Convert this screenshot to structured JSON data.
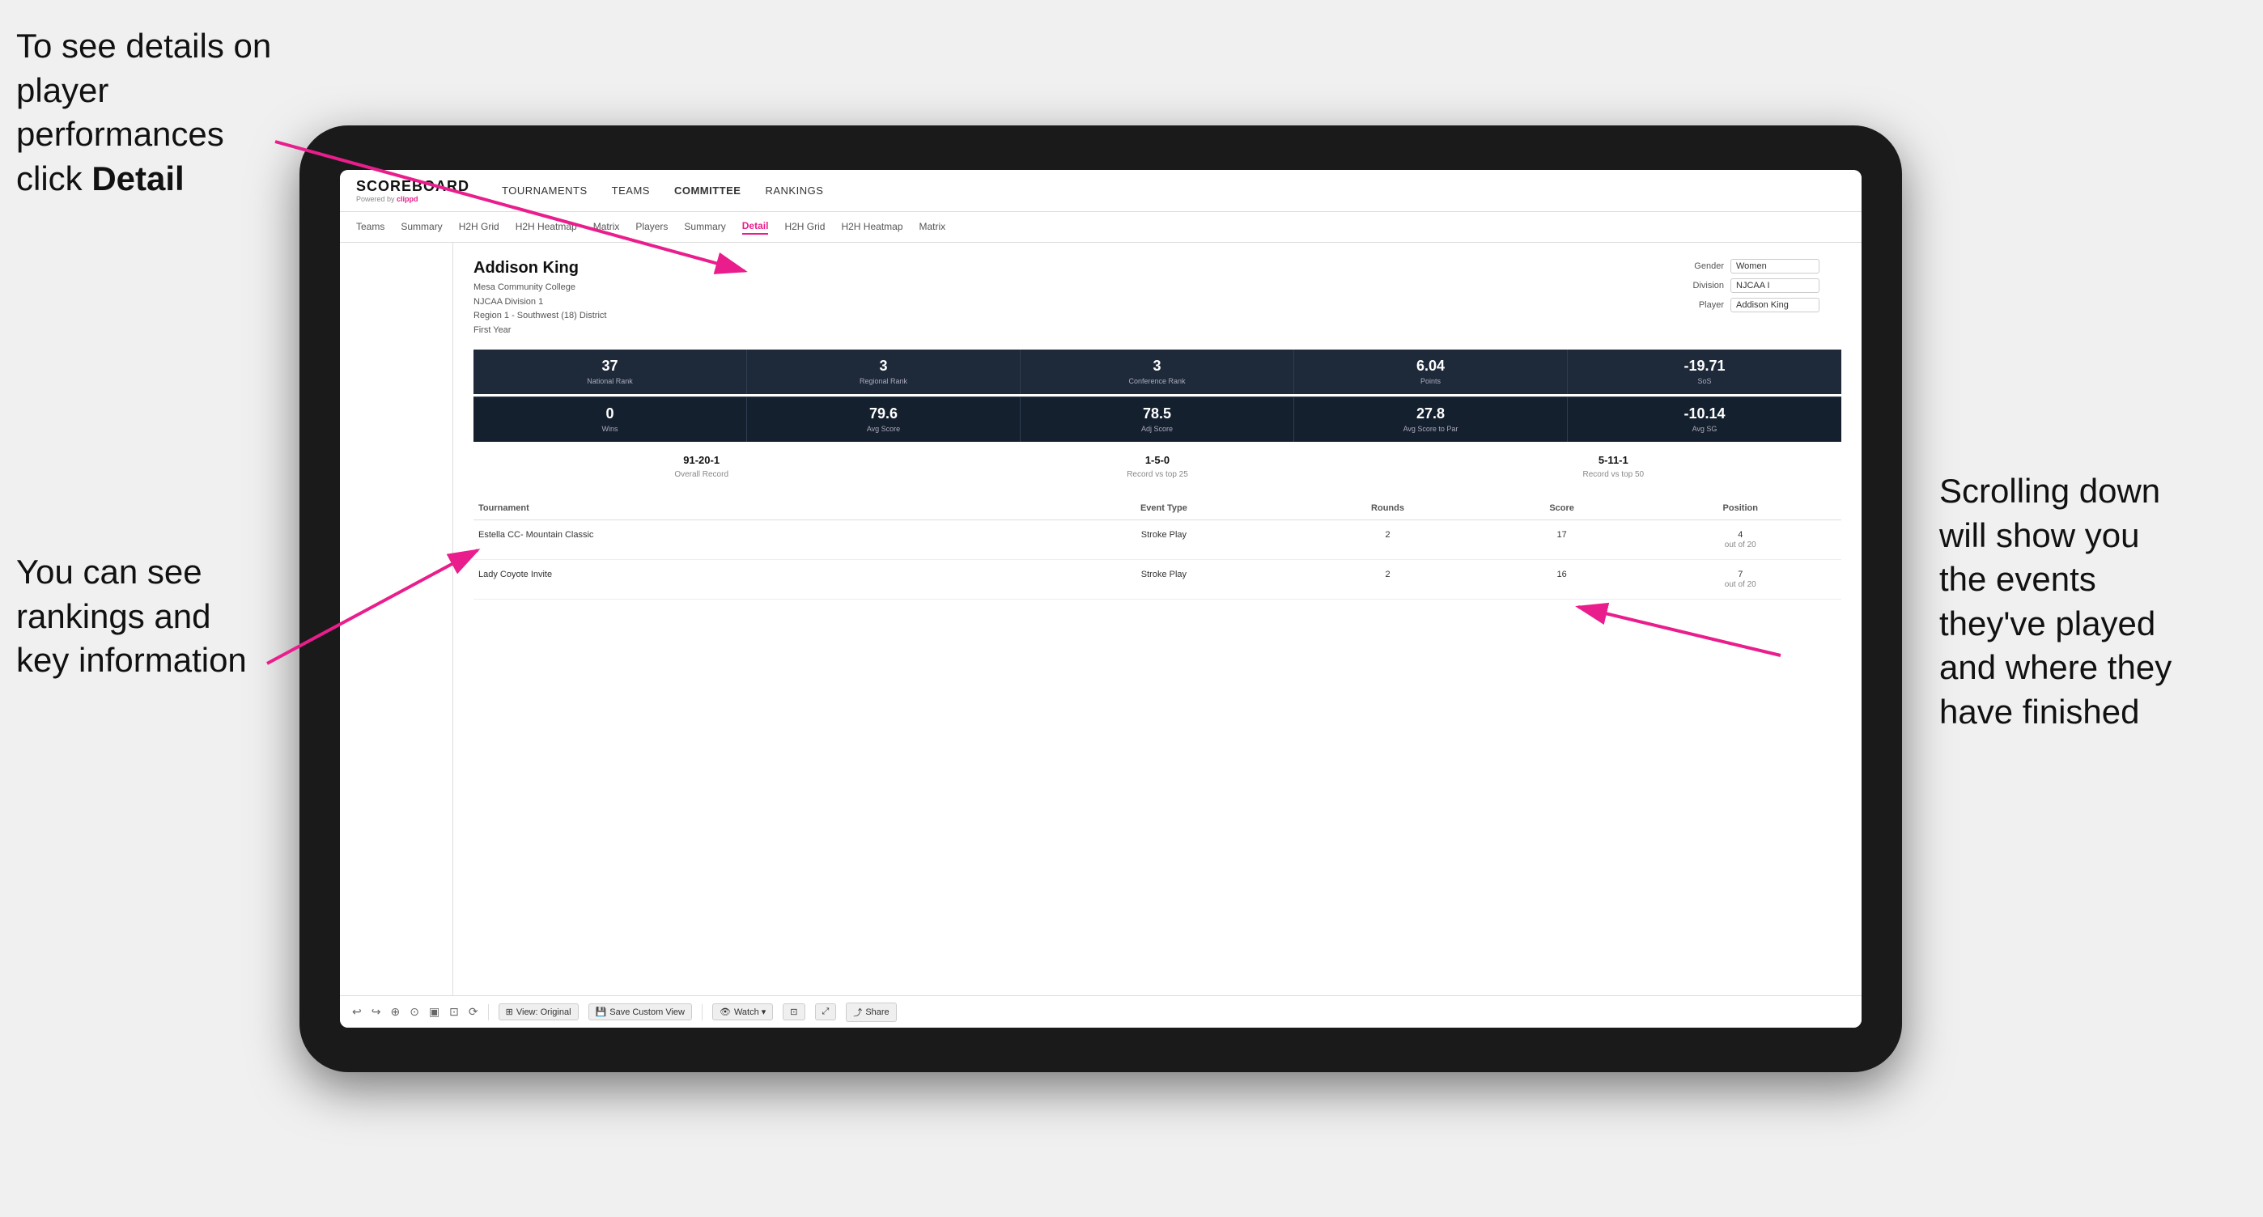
{
  "annotations": {
    "top_left": {
      "line1": "To see details on",
      "line2": "player performances",
      "line3_prefix": "click ",
      "line3_bold": "Detail"
    },
    "bottom_left": {
      "line1": "You can see",
      "line2": "rankings and",
      "line3": "key information"
    },
    "right": {
      "line1": "Scrolling down",
      "line2": "will show you",
      "line3": "the events",
      "line4": "they've played",
      "line5": "and where they",
      "line6": "have finished"
    }
  },
  "nav": {
    "logo": "SCOREBOARD",
    "powered_by": "Powered by",
    "clippd": "clippd",
    "main_items": [
      "TOURNAMENTS",
      "TEAMS",
      "COMMITTEE",
      "RANKINGS"
    ],
    "sub_items": [
      "Teams",
      "Summary",
      "H2H Grid",
      "H2H Heatmap",
      "Matrix",
      "Players",
      "Summary",
      "Detail",
      "H2H Grid",
      "H2H Heatmap",
      "Matrix"
    ]
  },
  "player": {
    "name": "Addison King",
    "college": "Mesa Community College",
    "division": "NJCAA Division 1",
    "region": "Region 1 - Southwest (18) District",
    "year": "First Year",
    "gender_label": "Gender",
    "gender_value": "Women",
    "division_label": "Division",
    "division_value": "NJCAA I",
    "player_label": "Player",
    "player_value": "Addison King"
  },
  "stats_row1": [
    {
      "value": "37",
      "label": "National Rank"
    },
    {
      "value": "3",
      "label": "Regional Rank"
    },
    {
      "value": "3",
      "label": "Conference Rank"
    },
    {
      "value": "6.04",
      "label": "Points"
    },
    {
      "value": "-19.71",
      "label": "SoS"
    }
  ],
  "stats_row2": [
    {
      "value": "0",
      "label": "Wins"
    },
    {
      "value": "79.6",
      "label": "Avg Score"
    },
    {
      "value": "78.5",
      "label": "Adj Score"
    },
    {
      "value": "27.8",
      "label": "Avg Score to Par"
    },
    {
      "value": "-10.14",
      "label": "Avg SG"
    }
  ],
  "records": [
    {
      "value": "91-20-1",
      "label": "Overall Record"
    },
    {
      "value": "1-5-0",
      "label": "Record vs top 25"
    },
    {
      "value": "5-11-1",
      "label": "Record vs top 50"
    }
  ],
  "table": {
    "headers": [
      "Tournament",
      "Event Type",
      "Rounds",
      "Score",
      "Position"
    ],
    "rows": [
      {
        "tournament": "Estella CC- Mountain Classic",
        "event_type": "Stroke Play",
        "rounds": "2",
        "score": "17",
        "position": "4",
        "position_detail": "out of 20"
      },
      {
        "tournament": "Lady Coyote Invite",
        "event_type": "Stroke Play",
        "rounds": "2",
        "score": "16",
        "position": "7",
        "position_detail": "out of 20"
      }
    ]
  },
  "toolbar": {
    "buttons": [
      "View: Original",
      "Save Custom View",
      "Watch ▾",
      "Share"
    ],
    "icons": [
      "↩",
      "↪",
      "⊕",
      "⊙",
      "▣",
      "⊡",
      "⟳"
    ]
  }
}
